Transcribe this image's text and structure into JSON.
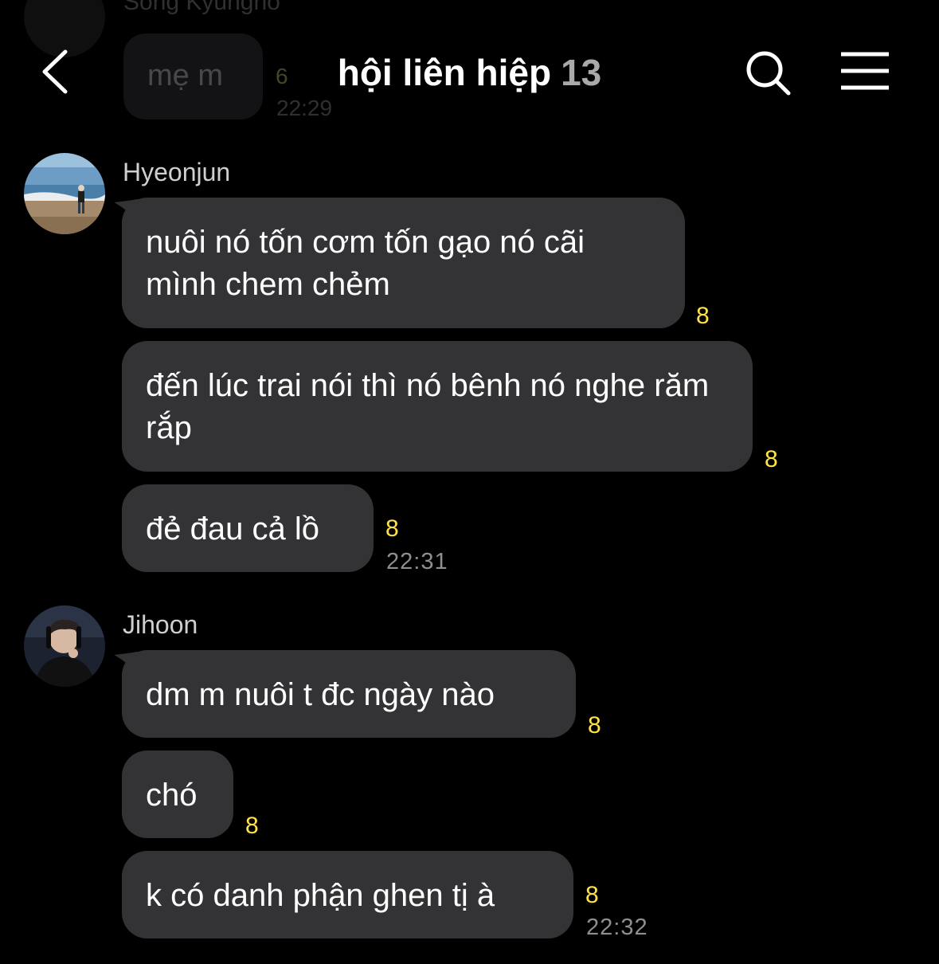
{
  "previous": {
    "sender": "Song Kyungho",
    "text": "mẹ m",
    "unread": "6",
    "time": "22:29"
  },
  "header": {
    "title": "hội liên hiệp",
    "member_count": "13"
  },
  "groups": [
    {
      "sender": "Hyeonjun",
      "messages": [
        {
          "text": "nuôi nó tốn cơm tốn gạo nó cãi mình chem chẻm",
          "unread": "8"
        },
        {
          "text": "đến lúc trai nói thì nó bênh nó nghe răm rắp",
          "unread": "8"
        },
        {
          "text": "đẻ đau cả lồ",
          "unread": "8",
          "time": "22:31"
        }
      ]
    },
    {
      "sender": "Jihoon",
      "messages": [
        {
          "text": "dm m nuôi t đc ngày nào",
          "unread": "8"
        },
        {
          "text": "chó",
          "unread": "8"
        },
        {
          "text": "k có danh phận ghen tị à",
          "unread": "8",
          "time": "22:32"
        }
      ]
    }
  ]
}
